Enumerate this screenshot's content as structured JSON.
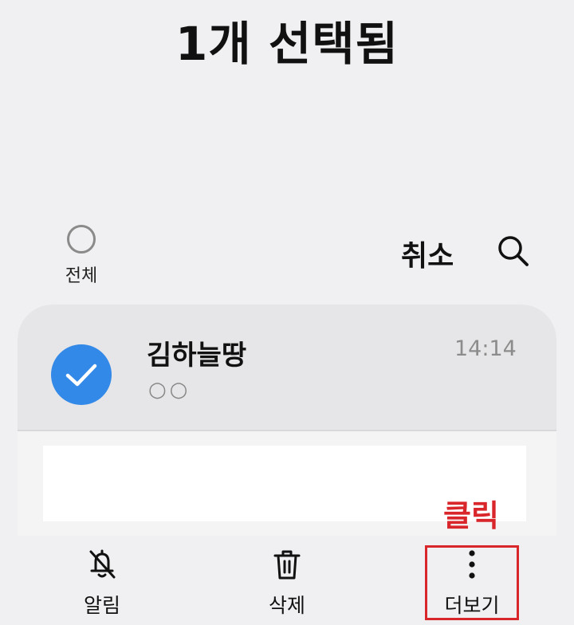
{
  "header": {
    "title": "1개 선택됨"
  },
  "toolbar": {
    "select_all_label": "전체",
    "cancel_label": "취소",
    "search_icon": "search-icon"
  },
  "conversation": {
    "name": "김하늘땅",
    "preview": "○○",
    "time": "14:14",
    "selected": true,
    "avatar_color": "#3389e8"
  },
  "annotation": {
    "text": "클릭",
    "color": "#d8262b"
  },
  "bottom_actions": [
    {
      "label": "알림",
      "icon": "bell-off-icon"
    },
    {
      "label": "삭제",
      "icon": "trash-icon"
    },
    {
      "label": "더보기",
      "icon": "more-vertical-icon"
    }
  ]
}
